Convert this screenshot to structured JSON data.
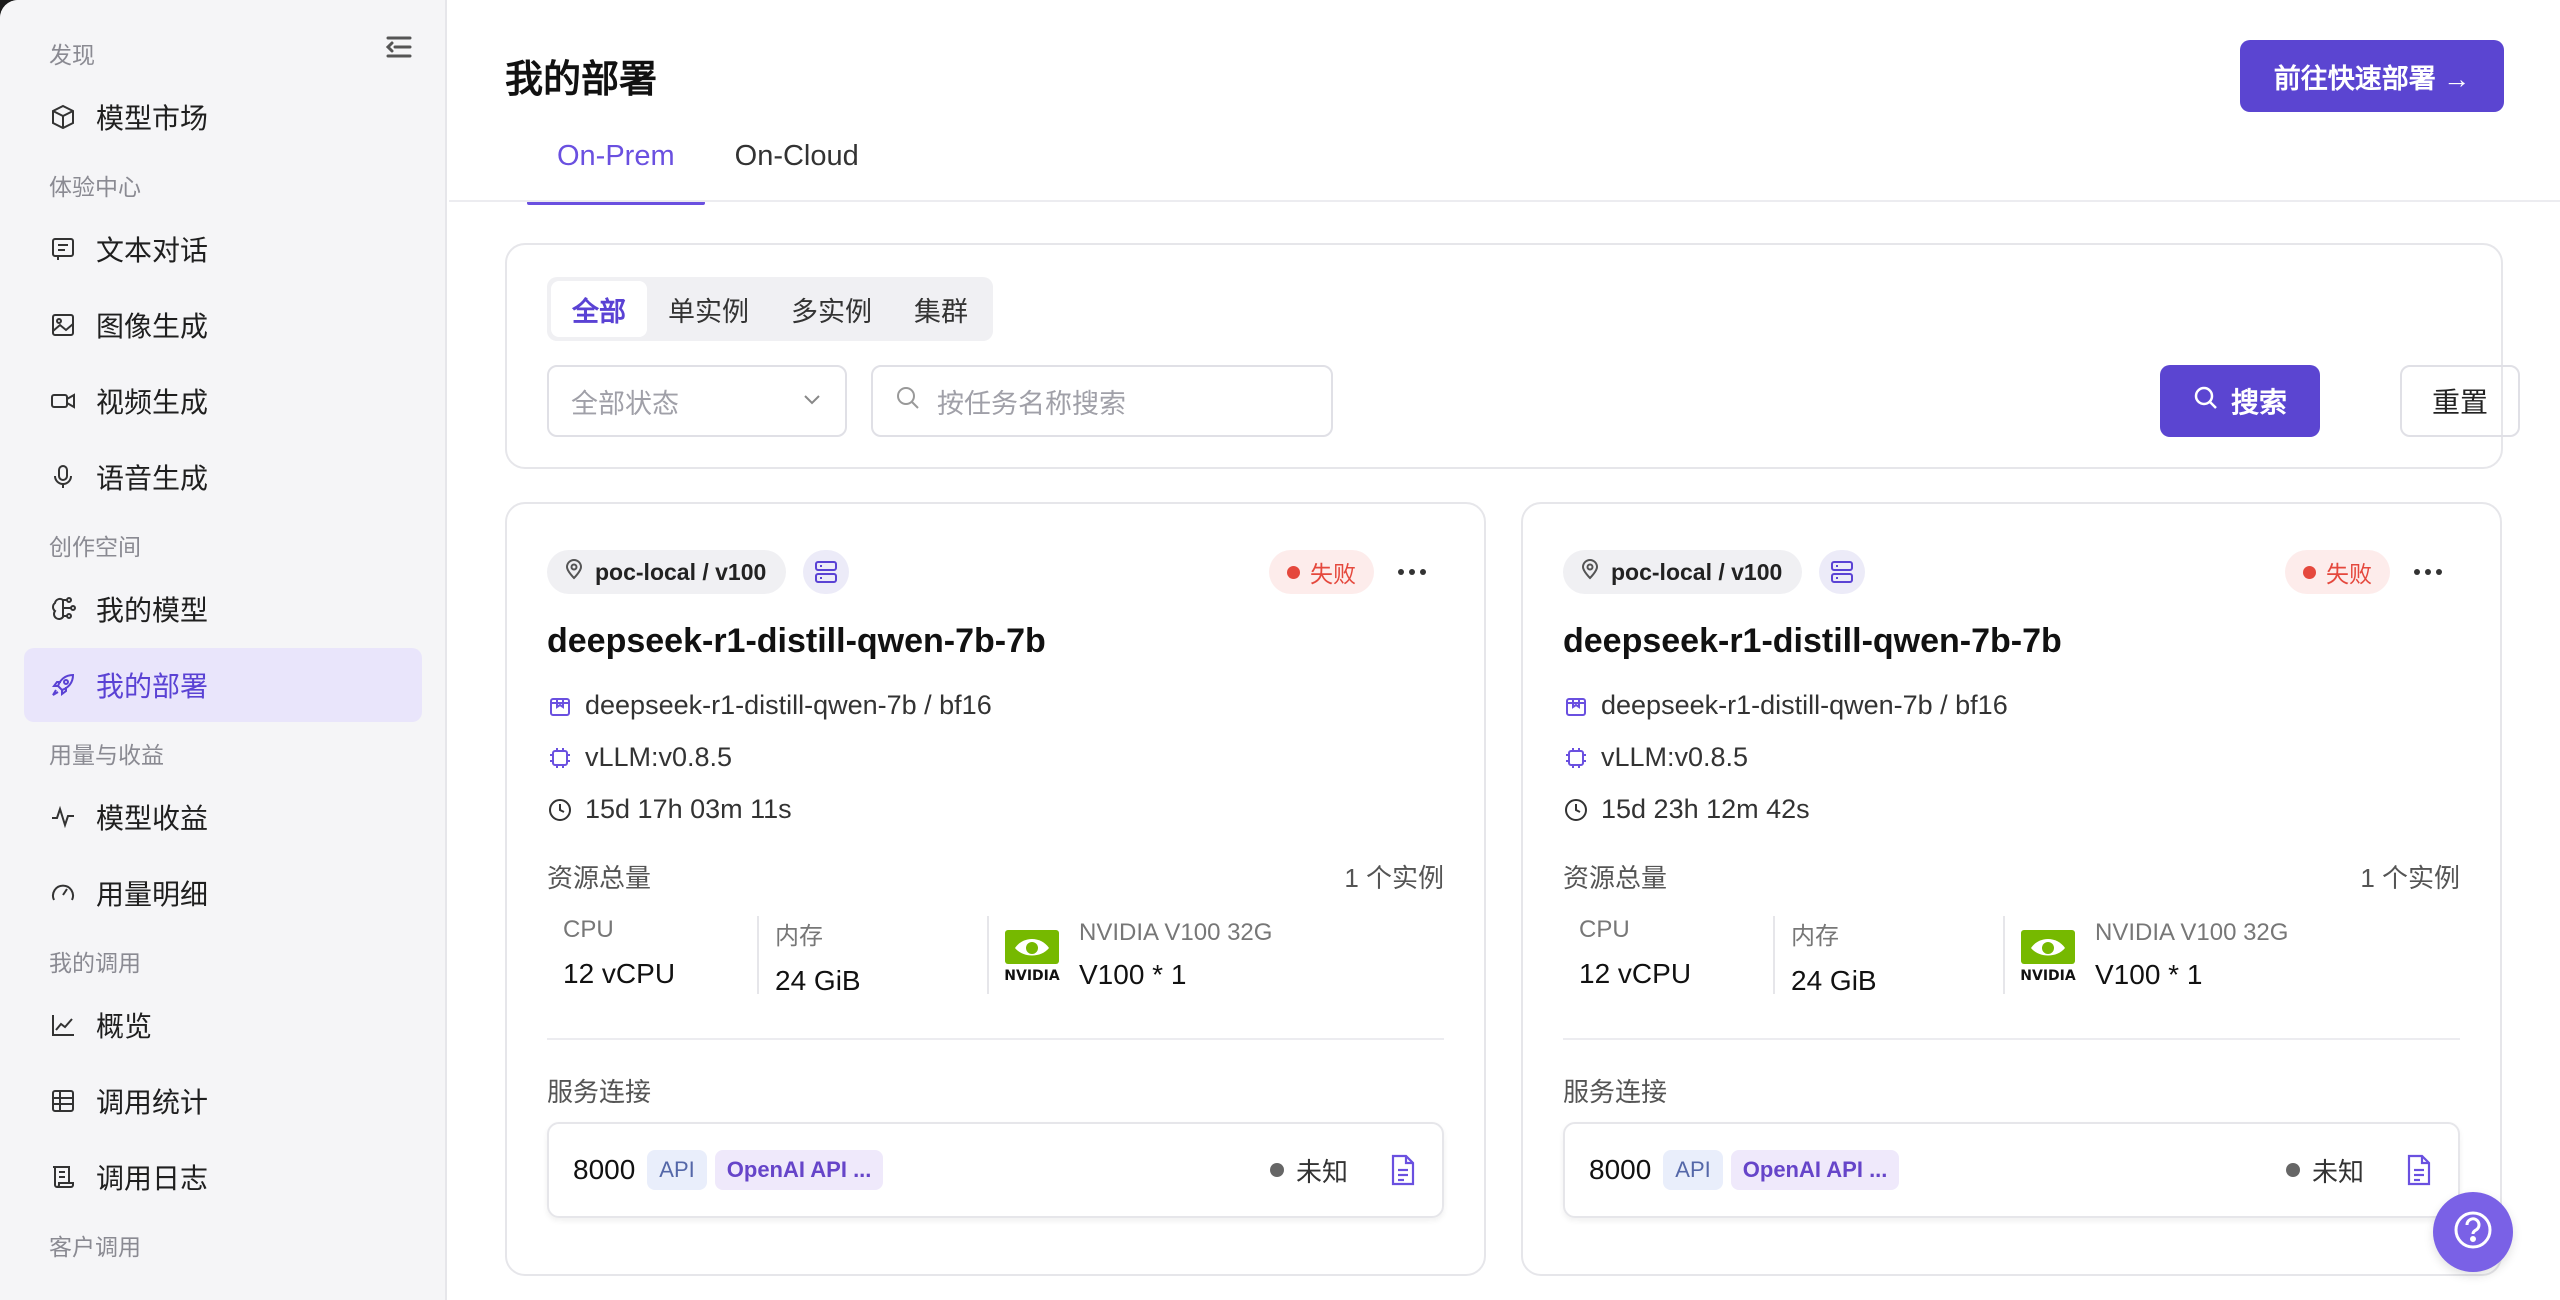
{
  "sidebar": {
    "groups": [
      "发现",
      "体验中心",
      "创作空间",
      "用量与收益",
      "我的调用",
      "客户调用"
    ],
    "items": [
      {
        "label": "模型市场",
        "icon": "cube-icon"
      },
      {
        "label": "文本对话",
        "icon": "chat-icon"
      },
      {
        "label": "图像生成",
        "icon": "image-icon"
      },
      {
        "label": "视频生成",
        "icon": "video-icon"
      },
      {
        "label": "语音生成",
        "icon": "mic-icon"
      },
      {
        "label": "我的模型",
        "icon": "brain-icon"
      },
      {
        "label": "我的部署",
        "icon": "rocket-icon",
        "active": true
      },
      {
        "label": "模型收益",
        "icon": "pulse-icon"
      },
      {
        "label": "用量明细",
        "icon": "gauge-icon"
      },
      {
        "label": "概览",
        "icon": "chart-icon"
      },
      {
        "label": "调用统计",
        "icon": "table-icon"
      },
      {
        "label": "调用日志",
        "icon": "log-icon"
      }
    ]
  },
  "header": {
    "title": "我的部署",
    "quick_deploy": "前往快速部署 →",
    "tabs": [
      "On-Prem",
      "On-Cloud"
    ]
  },
  "filter": {
    "segments": [
      "全部",
      "单实例",
      "多实例",
      "集群"
    ],
    "status_select": "全部状态",
    "search_placeholder": "按任务名称搜索",
    "search_btn": "搜索",
    "reset_btn": "重置"
  },
  "cards": [
    {
      "location": "poc-local / v100",
      "status": "失败",
      "title": "deepseek-r1-distill-qwen-7b-7b",
      "model": "deepseek-r1-distill-qwen-7b / bf16",
      "engine": "vLLM:v0.8.5",
      "uptime": "15d 17h 03m 11s",
      "res_label": "资源总量",
      "instances": "1 个实例",
      "cpu_label": "CPU",
      "cpu": "12 vCPU",
      "mem_label": "内存",
      "mem": "24 GiB",
      "gpu_name": "NVIDIA V100 32G",
      "gpu": "V100 * 1",
      "conn_label": "服务连接",
      "port": "8000",
      "tag_api": "API",
      "tag_openai": "OpenAI API ...",
      "conn_status": "未知"
    },
    {
      "location": "poc-local / v100",
      "status": "失败",
      "title": "deepseek-r1-distill-qwen-7b-7b",
      "model": "deepseek-r1-distill-qwen-7b / bf16",
      "engine": "vLLM:v0.8.5",
      "uptime": "15d 23h 12m 42s",
      "res_label": "资源总量",
      "instances": "1 个实例",
      "cpu_label": "CPU",
      "cpu": "12 vCPU",
      "mem_label": "内存",
      "mem": "24 GiB",
      "gpu_name": "NVIDIA V100 32G",
      "gpu": "V100 * 1",
      "conn_label": "服务连接",
      "port": "8000",
      "tag_api": "API",
      "tag_openai": "OpenAI API ...",
      "conn_status": "未知"
    }
  ],
  "colors": {
    "accent": "#5b45d1",
    "fail": "#e5483d",
    "nvidia": "#76b900"
  }
}
